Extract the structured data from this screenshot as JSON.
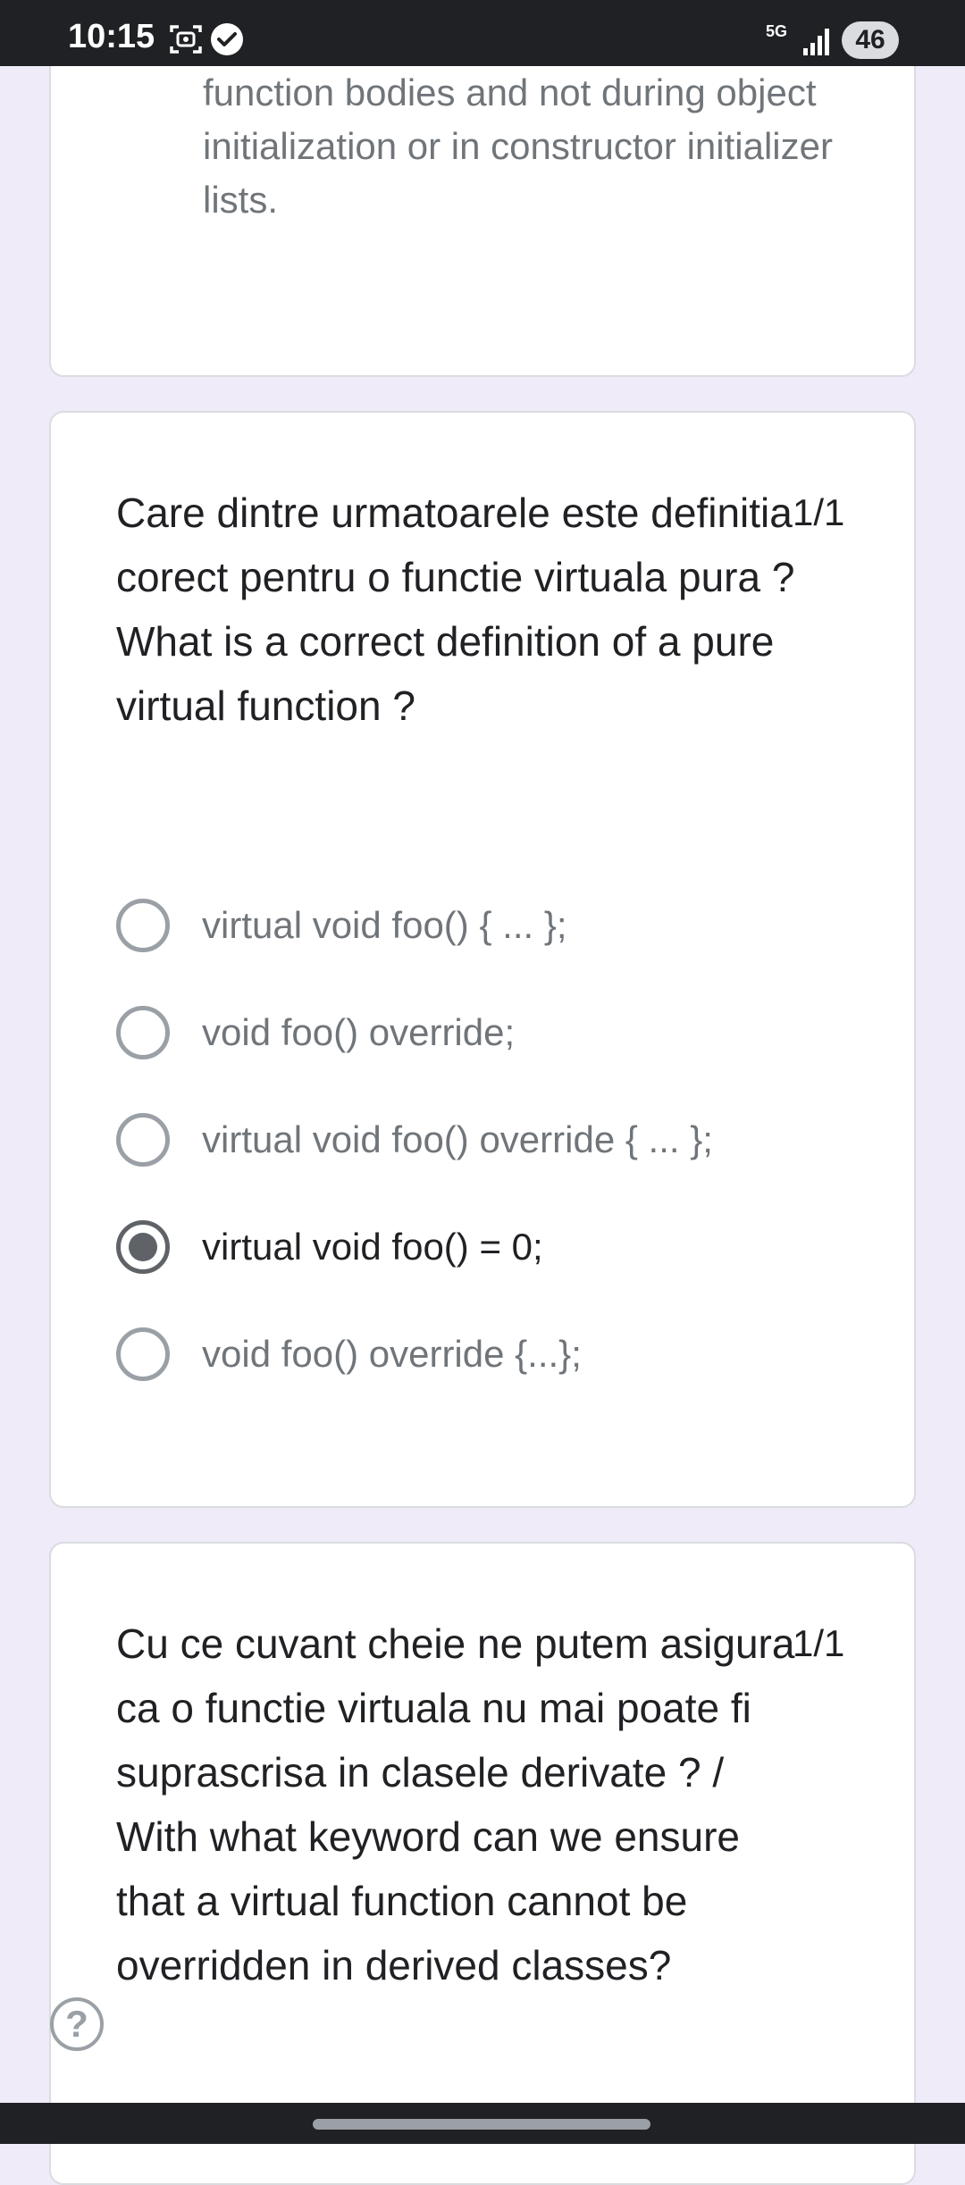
{
  "status_bar": {
    "time": "10:15",
    "network": "5G",
    "battery": "46",
    "icons": [
      "screenshot-icon",
      "check-circle-icon",
      "signal-icon"
    ]
  },
  "previous_card": {
    "text": "try blocks can only be used inside function bodies and not during object initialization or in constructor initializer lists."
  },
  "questions": [
    {
      "text": "Care dintre urmatoarele este definitia corect pentru o functie virtuala pura ? What is a correct definition of a pure virtual function ?",
      "score": "1/1",
      "options": [
        "virtual void foo() { ... };",
        "void foo() override;",
        "virtual void foo() override { ... };",
        "virtual void foo() = 0;",
        "void foo() override {...};"
      ],
      "selected_index": 3
    },
    {
      "text": "Cu ce cuvant cheie ne putem asigura ca o functie virtuala nu mai poate fi suprascrisa in clasele derivate ? /  With what keyword can we ensure that a virtual function cannot be overridden in derived classes?",
      "score": "1/1"
    }
  ],
  "help": {
    "icon": "?"
  },
  "colors": {
    "background": "#efebf8",
    "card": "#ffffff",
    "text_primary": "#202124",
    "text_secondary": "#70757a",
    "radio": "#9aa0a6",
    "radio_checked": "#5f6368"
  }
}
